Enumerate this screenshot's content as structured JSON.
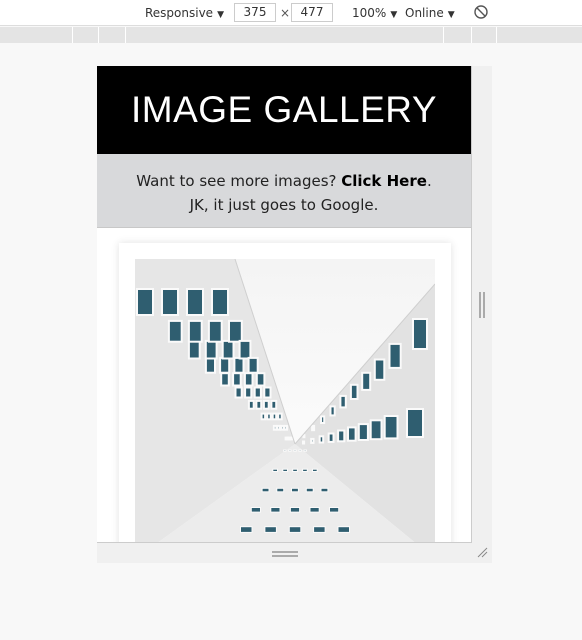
{
  "toolbar": {
    "device": "Responsive",
    "width": "375",
    "separator": "×",
    "height": "477",
    "zoom": "100%",
    "network": "Online",
    "caret": "▼"
  },
  "page": {
    "title": "IMAGE GALLERY",
    "notice_before": "Want to see more images? ",
    "notice_link": "Click Here",
    "notice_after": ". JK, it just goes to Google."
  },
  "colors": {
    "header_bg": "#000000",
    "notice_bg": "#d8d9db",
    "facade": "#e9e9e9",
    "window_glass": "#2f5e70"
  },
  "icons": [
    "rotate-icon",
    "resize-handle-icon"
  ]
}
